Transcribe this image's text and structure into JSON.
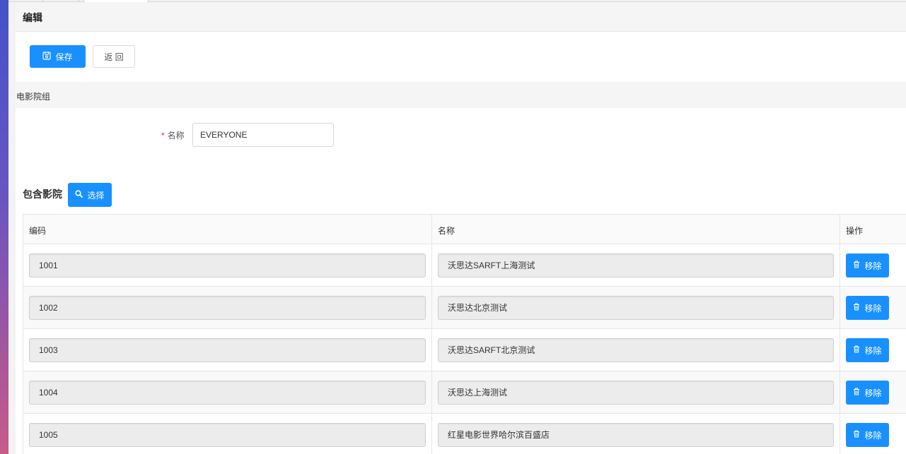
{
  "header": {
    "title": "编辑"
  },
  "toolbar": {
    "save_label": "保存",
    "back_label": "返 回",
    "accent": "#1890ff"
  },
  "section": {
    "title": "电影院组"
  },
  "form": {
    "name_label": "名称",
    "required_mark": "*",
    "name_value": "EVERYONE"
  },
  "included": {
    "title": "包含影院",
    "select_label": "选择"
  },
  "table": {
    "columns": [
      "编码",
      "名称",
      "操作"
    ],
    "remove_label": "移除",
    "rows": [
      {
        "code": "1001",
        "name": "沃思达SARFT上海测试"
      },
      {
        "code": "1002",
        "name": "沃思达北京测试"
      },
      {
        "code": "1003",
        "name": "沃思达SARFT北京测试"
      },
      {
        "code": "1004",
        "name": "沃思达上海测试"
      },
      {
        "code": "1005",
        "name": "红星电影世界哈尔滨百盛店"
      }
    ]
  }
}
